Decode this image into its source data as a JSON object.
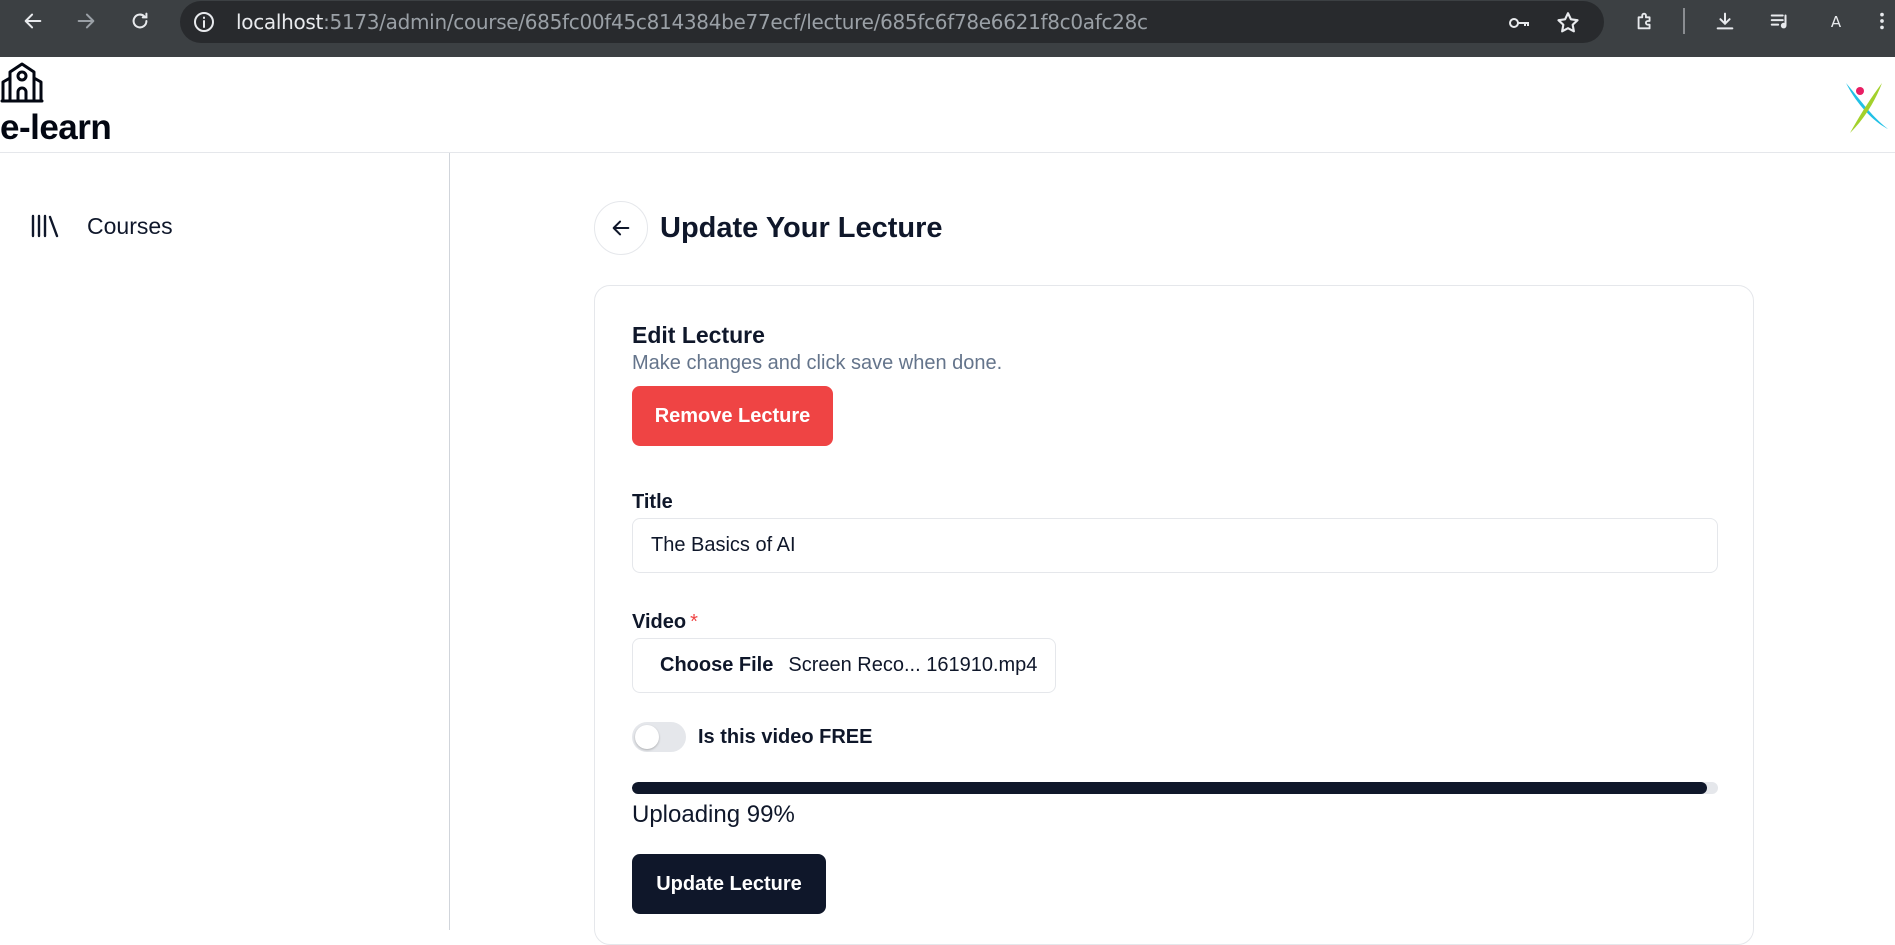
{
  "browser": {
    "url_host": "localhost",
    "url_path": ":5173/admin/course/685fc00f45c814384be77ecf/lecture/685fc6f78e6621f8c0afc28c",
    "profile_letter": "A"
  },
  "header": {
    "logo_text": "e-learn"
  },
  "sidebar": {
    "items": [
      {
        "label": "Courses",
        "icon": "library-icon"
      }
    ]
  },
  "main": {
    "title": "Update Your Lecture",
    "card": {
      "title": "Edit Lecture",
      "description": "Make changes and click save when done.",
      "remove_button": "Remove Lecture",
      "title_label": "Title",
      "title_value": "The Basics of AI",
      "video_label": "Video",
      "video_required": "*",
      "file_button": "Choose File",
      "file_name": "Screen Reco... 161910.mp4",
      "free_label": "Is this video FREE",
      "free_enabled": false,
      "upload_progress": 99,
      "upload_text": "Uploading 99%",
      "update_button": "Update Lecture"
    }
  },
  "colors": {
    "danger": "#ef4444",
    "primary": "#0f172a",
    "muted": "#64748b"
  }
}
